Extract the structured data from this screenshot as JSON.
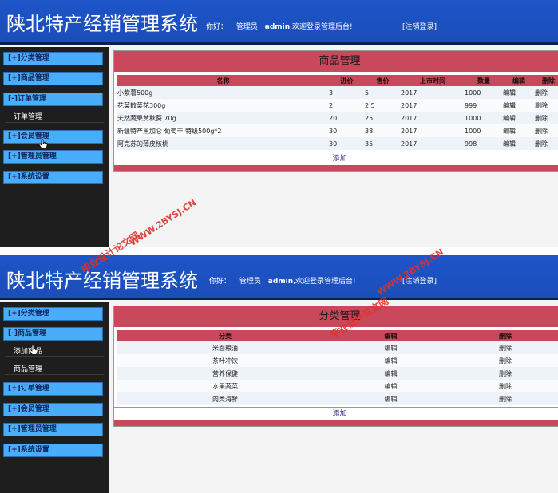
{
  "app": {
    "title": "陕北特产经销管理系统",
    "greet_prefix": "你好：",
    "role": "管理员",
    "username": "admin",
    "welcome": ",欢迎登录管理后台!",
    "logout_label": "[注销登录]"
  },
  "shot1": {
    "menu": {
      "category": "[+]分类管理",
      "product": "[+]商品管理",
      "order": "[-]订单管理",
      "order_sub": "订单管理",
      "member": "[+]会员管理",
      "admin": "[+]管理员管理",
      "settings": "[+]系统设置"
    },
    "panel_title": "商品管理",
    "columns": [
      "名称",
      "进价",
      "售价",
      "上市时间",
      "数量",
      "编辑",
      "删除"
    ],
    "rows": [
      [
        "小紫薯500g",
        "3",
        "5",
        "2017",
        "1000",
        "编辑",
        "删除"
      ],
      [
        "花菜散菜花300g",
        "2",
        "2.5",
        "2017",
        "999",
        "编辑",
        "删除"
      ],
      [
        "天然蔬果黄秋葵 70g",
        "20",
        "25",
        "2017",
        "1000",
        "编辑",
        "删除"
      ],
      [
        "新疆特产黑加仑 葡萄干 特级500g*2",
        "30",
        "38",
        "2017",
        "1000",
        "编辑",
        "删除"
      ],
      [
        "阿克苏的薄皮核桃",
        "30",
        "35",
        "2017",
        "998",
        "编辑",
        "删除"
      ]
    ],
    "add_label": "添加"
  },
  "shot2": {
    "menu": {
      "category": "[+]分类管理",
      "product": "[-]商品管理",
      "product_sub_add": "添加商品",
      "product_sub_manage": "商品管理",
      "order": "[+]订单管理",
      "member": "[+]会员管理",
      "admin": "[+]管理员管理",
      "settings": "[+]系统设置"
    },
    "panel_title": "分类管理",
    "columns": [
      "分类",
      "编辑",
      "删除"
    ],
    "rows": [
      [
        "米面粮油",
        "编辑",
        "删除"
      ],
      [
        "茶叶冲饮",
        "编辑",
        "删除"
      ],
      [
        "营养保健",
        "编辑",
        "删除"
      ],
      [
        "水果蔬菜",
        "编辑",
        "删除"
      ],
      [
        "肉类海鲜",
        "编辑",
        "删除"
      ]
    ],
    "add_label": "添加"
  },
  "watermarks": {
    "site_name": "毕业设计论文网",
    "site_url": "WWW.2BYSJ.CN"
  },
  "colors": {
    "header_blue": "#1d54c8",
    "nav_blue": "#48aefb",
    "panel_red": "#c9485b",
    "sidebar_dark": "#1e1e1e",
    "watermark_red": "#e0332a"
  },
  "icons": [
    "hand-pointer-icon"
  ]
}
